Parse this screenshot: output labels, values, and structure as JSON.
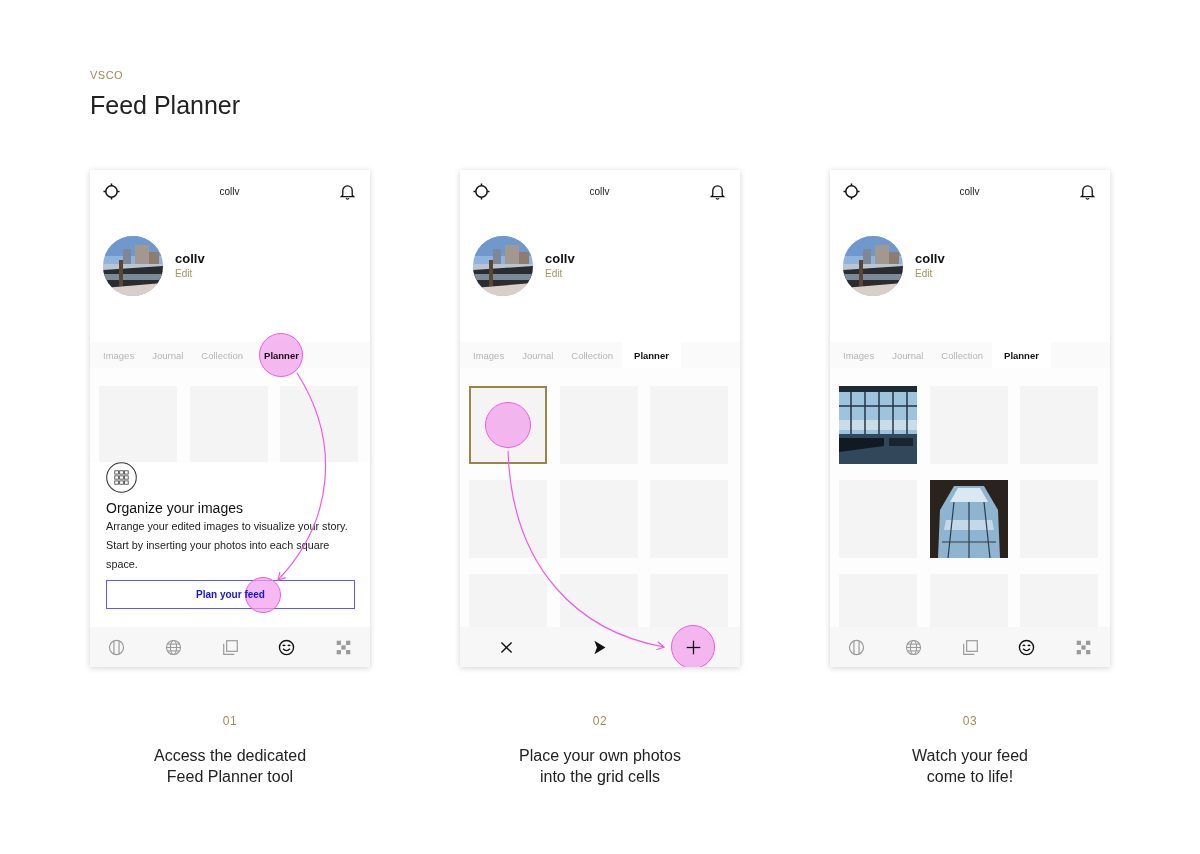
{
  "brand": "VSCO",
  "title": "Feed Planner",
  "steps": [
    {
      "number": "01",
      "caption": [
        "Access the dedicated",
        "Feed Planner tool"
      ],
      "phone": {
        "header_title": "collv",
        "profile": {
          "name": "collv",
          "edit_label": "Edit"
        },
        "tabs": [
          {
            "label": "Images",
            "selected": false,
            "highlighted": false
          },
          {
            "label": "Journal",
            "selected": false,
            "highlighted": false
          },
          {
            "label": "Collection",
            "selected": false,
            "highlighted": false
          },
          {
            "label": "Planner",
            "selected": true,
            "highlighted": true
          }
        ],
        "cells": [
          {
            "kind": "empty"
          },
          {
            "kind": "empty"
          },
          {
            "kind": "empty"
          }
        ],
        "intro_card": {
          "title": "Organize your images",
          "text": "Arrange your edited images to visualize your story. Start by inserting your photos into each square space.",
          "button": {
            "label": "Plan your feed",
            "highlighted": true
          }
        },
        "toolbar": {
          "kind": "nav",
          "items": [
            {
              "kind": "striped-circle",
              "selected": false,
              "highlighted": false
            },
            {
              "kind": "globe",
              "selected": false,
              "highlighted": false
            },
            {
              "kind": "stacked-squares",
              "selected": false,
              "highlighted": false
            },
            {
              "kind": "smiley",
              "selected": true,
              "highlighted": false
            },
            {
              "kind": "checker",
              "selected": false,
              "highlighted": false
            }
          ]
        },
        "arrow": {
          "kind": "tab-to-button"
        }
      }
    },
    {
      "number": "02",
      "caption": [
        "Place your own photos",
        "into the grid cells"
      ],
      "phone": {
        "header_title": "collv",
        "profile": {
          "name": "collv",
          "edit_label": "Edit"
        },
        "tabs": [
          {
            "label": "Images",
            "selected": false,
            "highlighted": false
          },
          {
            "label": "Journal",
            "selected": false,
            "highlighted": false
          },
          {
            "label": "Collection",
            "selected": false,
            "highlighted": false
          },
          {
            "label": "Planner",
            "selected": true,
            "highlighted": false
          }
        ],
        "cells": [
          {
            "kind": "empty",
            "selected": true,
            "highlighted": true
          },
          {
            "kind": "empty",
            "selected": false,
            "highlighted": false
          },
          {
            "kind": "empty",
            "selected": false,
            "highlighted": false
          },
          {
            "kind": "empty",
            "selected": false,
            "highlighted": false
          },
          {
            "kind": "empty",
            "selected": false,
            "highlighted": false
          },
          {
            "kind": "empty",
            "selected": false,
            "highlighted": false
          },
          {
            "kind": "empty",
            "selected": false,
            "highlighted": false
          },
          {
            "kind": "empty",
            "selected": false,
            "highlighted": false
          },
          {
            "kind": "empty",
            "selected": false,
            "highlighted": false
          }
        ],
        "toolbar": {
          "kind": "actions",
          "items": [
            {
              "kind": "close",
              "highlighted": false
            },
            {
              "kind": "send",
              "highlighted": false
            },
            {
              "kind": "add",
              "highlighted": true
            }
          ]
        },
        "arrow": {
          "kind": "cell-to-add"
        }
      }
    },
    {
      "number": "03",
      "caption": [
        "Watch your feed",
        "come to life!"
      ],
      "phone": {
        "header_title": "collv",
        "profile": {
          "name": "collv",
          "edit_label": "Edit"
        },
        "tabs": [
          {
            "label": "Images",
            "selected": false,
            "highlighted": false
          },
          {
            "label": "Journal",
            "selected": false,
            "highlighted": false
          },
          {
            "label": "Collection",
            "selected": false,
            "highlighted": false
          },
          {
            "label": "Planner",
            "selected": true,
            "highlighted": false
          }
        ],
        "cells": [
          {
            "kind": "picture",
            "selected": false,
            "highlighted": false
          },
          {
            "kind": "empty",
            "selected": false,
            "highlighted": false
          },
          {
            "kind": "empty",
            "selected": false,
            "highlighted": false
          },
          {
            "kind": "empty",
            "selected": false,
            "highlighted": false
          },
          {
            "kind": "picture",
            "selected": false,
            "highlighted": false
          },
          {
            "kind": "empty",
            "selected": false,
            "highlighted": false
          },
          {
            "kind": "empty",
            "selected": false,
            "highlighted": false
          },
          {
            "kind": "empty",
            "selected": false,
            "highlighted": false
          },
          {
            "kind": "empty",
            "selected": false,
            "highlighted": false
          }
        ],
        "toolbar": {
          "kind": "nav",
          "items": [
            {
              "kind": "striped-circle",
              "selected": false,
              "highlighted": false
            },
            {
              "kind": "globe",
              "selected": false,
              "highlighted": false
            },
            {
              "kind": "stacked-squares",
              "selected": false,
              "highlighted": false
            },
            {
              "kind": "smiley",
              "selected": true,
              "highlighted": false
            },
            {
              "kind": "checker",
              "selected": false,
              "highlighted": false
            }
          ]
        }
      }
    }
  ]
}
